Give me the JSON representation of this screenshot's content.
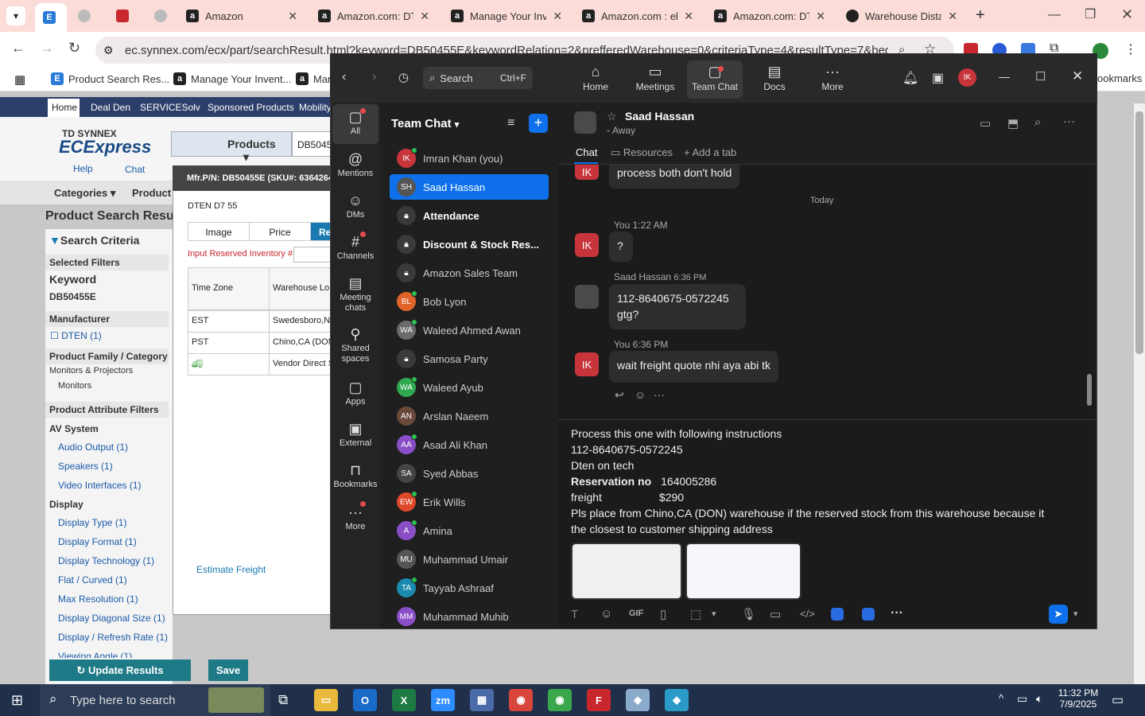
{
  "browser": {
    "tabs": [
      {
        "label": "",
        "icon": "ecx-icon"
      },
      {
        "label": "",
        "icon": "grey-icon"
      },
      {
        "label": "",
        "icon": "pdf-icon"
      },
      {
        "label": "",
        "icon": "grey-icon"
      },
      {
        "label": "Amazon",
        "icon": "amazon-icon"
      },
      {
        "label": "Amazon.com: DTE",
        "icon": "amazon-icon"
      },
      {
        "label": "Manage Your Inve",
        "icon": "amazon-icon"
      },
      {
        "label": "Amazon.com : eb",
        "icon": "amazon-icon"
      },
      {
        "label": "Amazon.com: DTE",
        "icon": "amazon-icon"
      },
      {
        "label": "Warehouse Distan",
        "icon": "openai-icon"
      }
    ],
    "url": "ec.synnex.com/ecx/part/searchResult.html?keyword=DB50455E&keywordRelation=2&prefferedWarehouse=0&criteriaType=4&resultType=7&begin=0&c...",
    "bookmarks": [
      "Product Search Res...",
      "Manage Your Invent...",
      "Mar"
    ],
    "bookmarks_right": "ookmarks"
  },
  "site": {
    "nav": [
      "Home",
      "Deal Den",
      "SERVICESolv",
      "Sponsored Products",
      "Mobility"
    ],
    "brand_top": "TD SYNNEX",
    "brand": "ECExpress",
    "help": "Help",
    "chat": "Chat",
    "products_dropdown": "Products",
    "search_value": "DB5045",
    "categories": "Categories",
    "product_menu": "Product I",
    "page_title": "Product Search Resu",
    "search_criteria": "Search Criteria",
    "selected_filters": "Selected Filters",
    "keyword_label": "Keyword",
    "keyword_value": "DB50455E",
    "manufacturer": "Manufacturer",
    "dten_filter": "DTEN (1)",
    "family": "Product Family / Category",
    "monitors_projectors": "Monitors & Projectors",
    "monitors": "Monitors",
    "attribute_filters": "Product Attribute Filters",
    "av_system": "AV System",
    "av_items": [
      "Audio Output (1)",
      "Speakers (1)",
      "Video Interfaces (1)"
    ],
    "display": "Display",
    "display_items": [
      "Display Type (1)",
      "Display Format (1)",
      "Display Technology (1)",
      "Flat / Curved (1)",
      "Max Resolution (1)",
      "Display Diagonal Size (1)",
      "Display / Refresh Rate (1)",
      "Viewing Angle (1)"
    ],
    "update_results": "Update Results",
    "save": "Save",
    "modal": {
      "header": "Mfr.P/N: DB50455E (SKU#: 6364264",
      "product": "DTEN D7 55",
      "tabs": [
        "Image",
        "Price",
        "Re"
      ],
      "reserved_label": "Input Reserved Inventory #",
      "col_timezone": "Time Zone",
      "col_warehouse": "Warehouse Lo",
      "rows": [
        {
          "tz": "EST",
          "wh": "Swedesboro,N"
        },
        {
          "tz": "PST",
          "wh": "Chino,CA (DON"
        },
        {
          "tz": "",
          "wh": "Vendor Direct S"
        }
      ],
      "estimate_freight": "Estimate Freight"
    }
  },
  "teams": {
    "search": "Search",
    "search_shortcut": "Ctrl+F",
    "top_tabs": [
      "Home",
      "Meetings",
      "Team Chat",
      "Docs",
      "More"
    ],
    "user_initials": "IK",
    "rail": [
      "All",
      "Mentions",
      "DMs",
      "Channels",
      "Meeting chats",
      "Shared spaces",
      "Apps",
      "External",
      "Bookmarks",
      "More"
    ],
    "list_title": "Team Chat",
    "chats": [
      {
        "name": "Imran Khan (you)",
        "initials": "IK",
        "color": "#c7353b",
        "online": true,
        "bold": false
      },
      {
        "name": "Saad Hassan",
        "initials": "SH",
        "color": "#555555",
        "online": false,
        "bold": false,
        "selected": true
      },
      {
        "name": "Attendance",
        "initials": "",
        "color": "#3a3a3a",
        "lock": true,
        "bold": true
      },
      {
        "name": "Discount & Stock Res...",
        "initials": "",
        "color": "#3a3a3a",
        "lock": true,
        "bold": true
      },
      {
        "name": "Amazon Sales Team",
        "initials": "",
        "color": "#3a3a3a",
        "lock": true,
        "bold": false
      },
      {
        "name": "Bob Lyon",
        "initials": "BL",
        "color": "#e0642a",
        "online": true,
        "bold": false
      },
      {
        "name": "Waleed Ahmed Awan",
        "initials": "WA",
        "color": "#6b6b6b",
        "online": true,
        "bold": false
      },
      {
        "name": "Samosa Party",
        "initials": "",
        "color": "#3a3a3a",
        "lock": true,
        "bold": false
      },
      {
        "name": "Waleed Ayub",
        "initials": "WA",
        "color": "#2fa84f",
        "online": true,
        "bold": false
      },
      {
        "name": "Arslan Naeem",
        "initials": "AN",
        "color": "#6a4a3a",
        "online": false,
        "bold": false
      },
      {
        "name": "Asad Ali Khan",
        "initials": "AA",
        "color": "#8a4fc7",
        "online": true,
        "bold": false
      },
      {
        "name": "Syed Abbas",
        "initials": "SA",
        "color": "#444444",
        "online": false,
        "bold": false
      },
      {
        "name": "Erik Wills",
        "initials": "EW",
        "color": "#e0482a",
        "online": true,
        "bold": false
      },
      {
        "name": "Amina",
        "initials": "A",
        "color": "#8a4fc7",
        "online": true,
        "bold": false
      },
      {
        "name": "Muhammad Umair",
        "initials": "MU",
        "color": "#555555",
        "online": false,
        "bold": false
      },
      {
        "name": "Tayyab Ashraaf",
        "initials": "TA",
        "color": "#1a8ab0",
        "online": true,
        "bold": false
      },
      {
        "name": "Muhammad Muhib",
        "initials": "MM",
        "color": "#8a4fc7",
        "online": false,
        "bold": false
      }
    ],
    "contact": {
      "name": "Saad Hassan",
      "status": "Away"
    },
    "chat_tabs": [
      "Chat",
      "Resources",
      "Add a tab"
    ],
    "messages": {
      "prev_text": "process both don't hold",
      "day_divider": "Today",
      "m1_meta": "You 1:22 AM",
      "m1_text": "?",
      "m2_meta_name": "Saad Hassan",
      "m2_meta_time": "6:36 PM",
      "m2_line1": "112-8640675-0572245",
      "m2_line2": "gtg?",
      "m3_meta": "You 6:36 PM",
      "m3_text": "wait freight quote nhi aya abi tk"
    },
    "composer": {
      "l1": "Process this one with following instructions",
      "l2": "112-8640675-0572245",
      "l3": "Dten on tech",
      "l4_label": "Reservation no",
      "l4_value": "164005286",
      "l5_label": "freight",
      "l5_value": "$290",
      "l6": "Pls place from  Chino,CA (DON) warehouse  if the reserved stock from this warehouse because it",
      "l7": "the closest to customer shipping address",
      "gif": "GIF"
    }
  },
  "taskbar": {
    "search_placeholder": "Type here to search",
    "time": "11:32 PM",
    "date": "7/9/2025"
  }
}
